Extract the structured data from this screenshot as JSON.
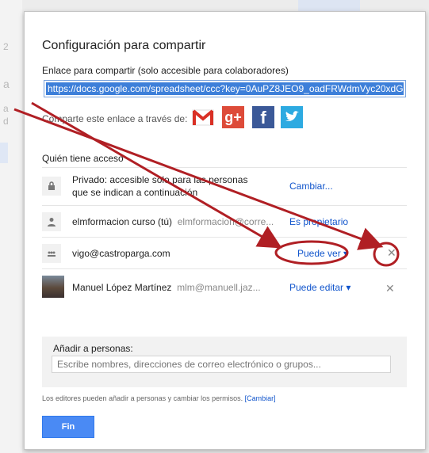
{
  "dialog": {
    "title": "Configuración para compartir",
    "link_label": "Enlace para compartir (solo accesible para colaboradores)",
    "link_url": "https://docs.google.com/spreadsheet/ccc?key=0AuPZ8JEO9_oadFRWdmVyc20xdG",
    "share_via_label": "Comparte este enlace a través de:",
    "access_title": "Quién tiene acceso"
  },
  "social_icons": [
    "gmail-icon",
    "google-plus-icon",
    "facebook-icon",
    "twitter-icon"
  ],
  "social_text": {
    "gplus": "g+",
    "facebook": "f"
  },
  "access_rows": [
    {
      "icon": "lock-icon",
      "name_line1": "Privado: accesible solo para las personas",
      "name_line2": "que se indican a continuación",
      "action": "Cambiar..."
    },
    {
      "icon": "person-icon",
      "name": "elmformacion curso (tú)",
      "email": "elmformacion@corre...",
      "action": "Es propietario"
    },
    {
      "icon": "group-icon",
      "name": "vigo@castroparga.com",
      "action": "Puede ver ▾",
      "remove": "✕"
    },
    {
      "icon": "avatar",
      "name": "Manuel López Martínez",
      "email": "mlm@manuell.jaz...",
      "action": "Puede editar ▾",
      "remove": "✕"
    }
  ],
  "add_people": {
    "label": "Añadir a personas:",
    "placeholder": "Escribe nombres, direcciones de correo electrónico o grupos..."
  },
  "note": {
    "text": "Los editores pueden añadir a personas y cambiar los permisos.",
    "link": "[Cambiar]"
  },
  "done_label": "Fin",
  "colors": {
    "accent": "#4a8af4",
    "link": "#1155cc",
    "annotation": "#b01f24"
  }
}
